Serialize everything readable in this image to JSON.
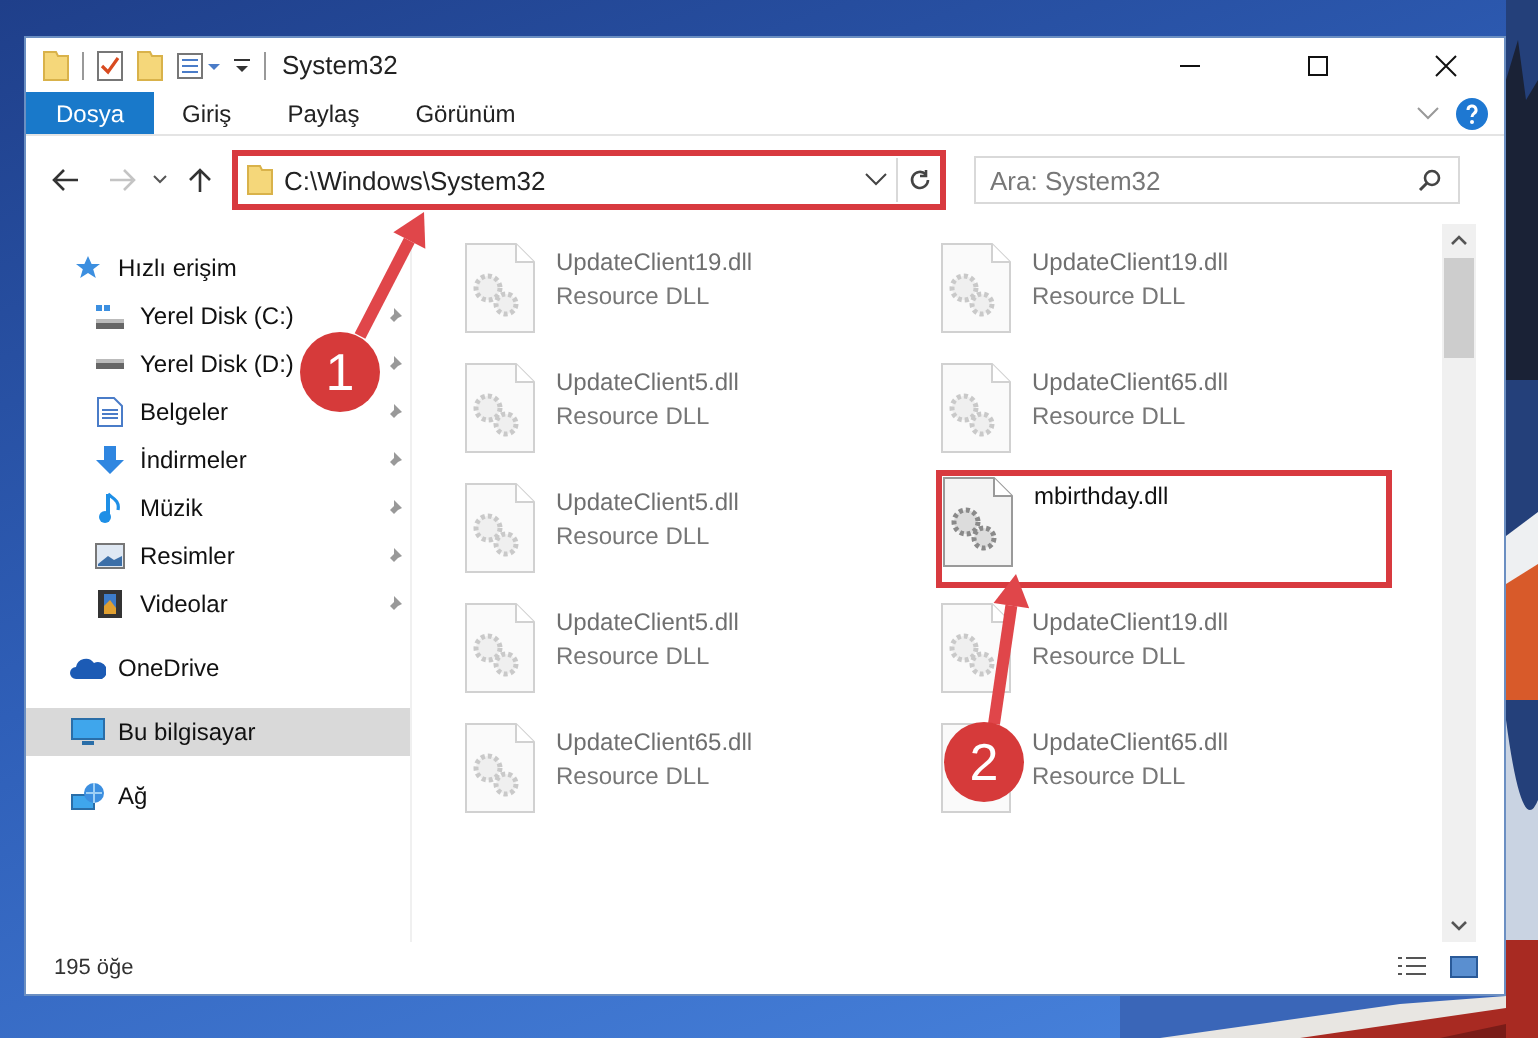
{
  "window": {
    "title": "System32"
  },
  "ribbon": {
    "tabs": [
      {
        "label": "Dosya",
        "selected": true
      },
      {
        "label": "Giriş",
        "selected": false
      },
      {
        "label": "Paylaş",
        "selected": false
      },
      {
        "label": "Görünüm",
        "selected": false
      }
    ]
  },
  "address_bar": {
    "path": "C:\\Windows\\System32",
    "highlighted": true,
    "search": {
      "placeholder": "Ara: System32"
    },
    "back_disabled": false,
    "forward_disabled": true
  },
  "sidebar": {
    "items": [
      {
        "label": "Hızlı erişim",
        "kind": "star",
        "selected": false,
        "children": [
          {
            "label": "Yerel Disk (C:)",
            "kind": "drive-c",
            "pinned": true,
            "selected": false
          },
          {
            "label": "Yerel Disk (D:)",
            "kind": "drive",
            "pinned": true,
            "selected": false
          },
          {
            "label": "Belgeler",
            "kind": "documents",
            "pinned": true,
            "selected": false
          },
          {
            "label": "İndirmeler",
            "kind": "downloads",
            "pinned": true,
            "selected": false
          },
          {
            "label": "Müzik",
            "kind": "music",
            "pinned": true,
            "selected": false
          },
          {
            "label": "Resimler",
            "kind": "pictures",
            "pinned": true,
            "selected": false
          },
          {
            "label": "Videolar",
            "kind": "videos",
            "pinned": true,
            "selected": false
          }
        ]
      },
      {
        "label": "OneDrive",
        "kind": "cloud",
        "selected": false
      },
      {
        "label": "Bu bilgisayar",
        "kind": "computer",
        "selected": true
      },
      {
        "label": "Ağ",
        "kind": "network",
        "selected": false
      }
    ]
  },
  "files": [
    {
      "name": "UpdateClient19.dll",
      "description": "Resource DLL",
      "blurred": true,
      "highlighted": false
    },
    {
      "name": "UpdateClient19.dll",
      "description": "Resource DLL",
      "blurred": true,
      "highlighted": false
    },
    {
      "name": "UpdateClient5.dll",
      "description": "Resource DLL",
      "blurred": true,
      "highlighted": false
    },
    {
      "name": "UpdateClient65.dll",
      "description": "Resource DLL",
      "blurred": true,
      "highlighted": false
    },
    {
      "name": "UpdateClient5.dll",
      "description": "Resource DLL",
      "blurred": true,
      "highlighted": false
    },
    {
      "name": "mbirthday.dll",
      "blurred": false,
      "highlighted": true
    },
    {
      "name": "UpdateClient5.dll",
      "description": "Resource DLL",
      "blurred": true,
      "highlighted": false
    },
    {
      "name": "UpdateClient19.dll",
      "description": "Resource DLL",
      "blurred": true,
      "highlighted": false
    },
    {
      "name": "UpdateClient65.dll",
      "description": "Resource DLL",
      "blurred": true,
      "highlighted": false
    },
    {
      "name": "UpdateClient65.dll",
      "description": "Resource DLL",
      "blurred": true,
      "highlighted": false
    }
  ],
  "status_bar": {
    "item_count": "195 öğe"
  },
  "annotations": [
    {
      "kind": "arrow",
      "label": "1"
    },
    {
      "kind": "arrow",
      "label": "2"
    }
  ]
}
